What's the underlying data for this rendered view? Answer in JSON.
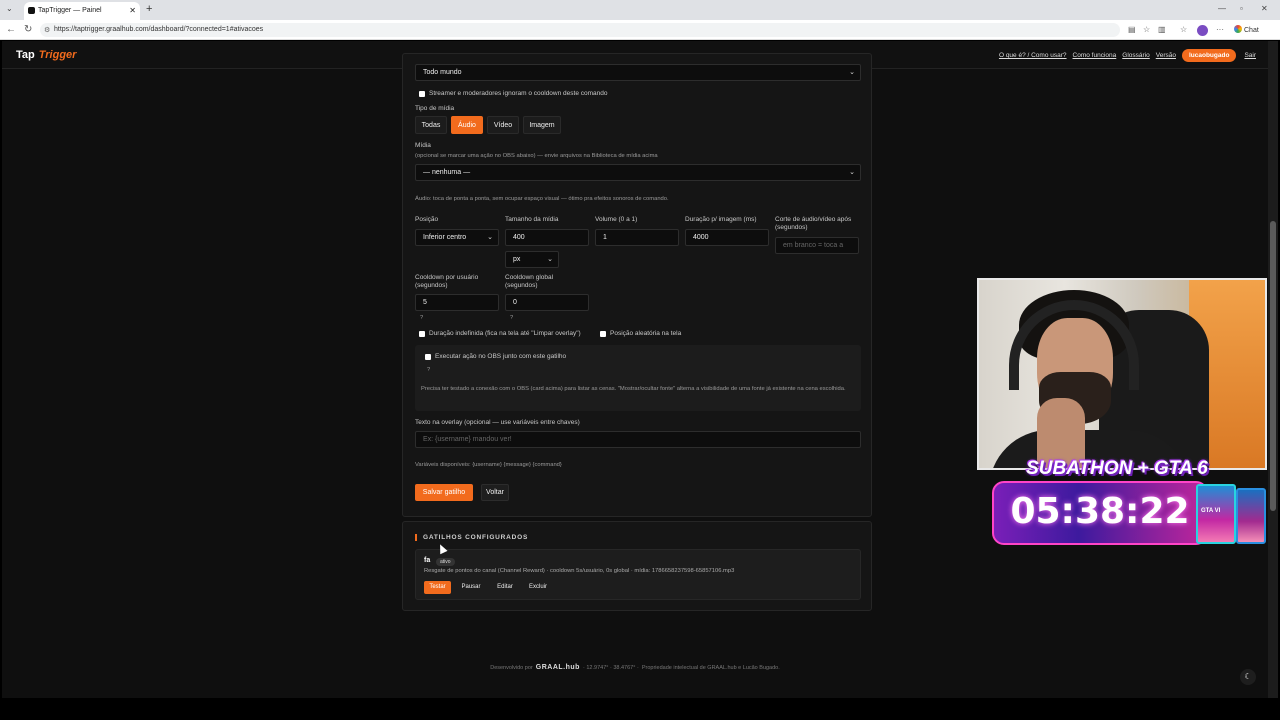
{
  "browser": {
    "tab_title": "TapTrigger — Painel",
    "url": "https://taptrigger.graalhub.com/dashboard/?connected=1#ativacoes",
    "chat_label": "Chat"
  },
  "header": {
    "logo_part1": "Tap",
    "logo_part2": "Trigger",
    "links": [
      "O que é? / Como usar?",
      "Como funciona",
      "Glossário",
      "Versão"
    ],
    "user": "lucaobugado",
    "logout": "Sair"
  },
  "form": {
    "audience_value": "Todo mundo",
    "cooldown_ignore_label": "Streamer e moderadores ignoram o cooldown deste comando",
    "media_type_label": "Tipo de mídia",
    "media_types": [
      "Todas",
      "Áudio",
      "Vídeo",
      "Imagem"
    ],
    "media_type_selected": "Áudio",
    "media_label": "Mídia",
    "media_hint": "(opcional se marcar uma ação no OBS abaixo) — envie arquivos na Biblioteca de mídia acima",
    "media_value": "— nenhuma —",
    "audio_hint": "Áudio: toca de ponta a ponta, sem ocupar espaço visual — ótimo pra efeitos sonoros de comando.",
    "position_label": "Posição",
    "position_value": "Inferior centro",
    "size_label": "Tamanho da mídia",
    "size_value": "400",
    "size_unit": "px",
    "volume_label": "Volume (0 a 1)",
    "volume_value": "1",
    "duration_label": "Duração p/ imagem (ms)",
    "duration_value": "4000",
    "cut_label": "Corte de áudio/vídeo após (segundos)",
    "cut_placeholder": "em branco = toca a",
    "user_cd_label": "Cooldown por usuário (segundos)",
    "user_cd_value": "5",
    "global_cd_label": "Cooldown global (segundos)",
    "global_cd_value": "0",
    "help_mark": "?",
    "indefinite_label": "Duração indefinida (fica na tela até \"Limpar overlay\")",
    "random_pos_label": "Posição aleatória na tela",
    "obs_label": "Executar ação no OBS junto com este gatilho",
    "obs_hint": "Precisa ter testado a conexão com o OBS (card acima) para listar as cenas. \"Mostrar/ocultar fonte\" alterna a visibilidade de uma fonte já existente na cena escolhida.",
    "overlay_text_label": "Texto na overlay (opcional — use variáveis entre chaves)",
    "overlay_text_placeholder": "Ex: {username} mandou ver!",
    "vars_hint": "Variáveis disponíveis: {username} {message} {command}",
    "save_label": "Salvar gatilho",
    "back_label": "Voltar"
  },
  "triggers": {
    "title": "GATILHOS CONFIGURADOS",
    "items": [
      {
        "name": "fa",
        "badge": "ativo",
        "desc": "Resgate de pontos do canal (Channel Reward) · cooldown 5s/usuário, 0s global · mídia: 1786658237598-65857106.mp3",
        "actions": [
          "Testar",
          "Pausar",
          "Editar",
          "Excluir"
        ]
      }
    ]
  },
  "footer": {
    "dev": "Desenvolvido por",
    "brand": "GRAAL.hub",
    "coords": "· 12.9747° · 38.4767° ·",
    "rights": "Propriedade intelectual de GRAAL.hub e Lucão Bugado."
  },
  "overlay": {
    "subathon_title": "SUBATHON + GTA 6",
    "timer": "05:38:22",
    "accent": "#f26b1d"
  }
}
